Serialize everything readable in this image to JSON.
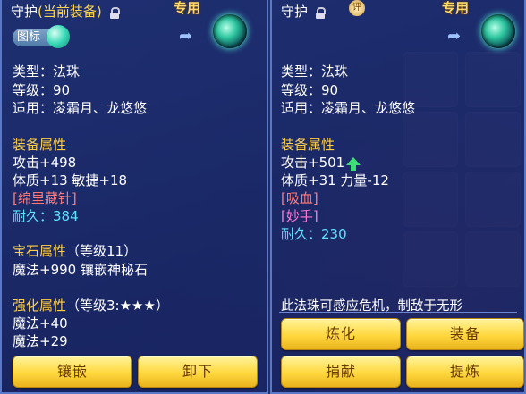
{
  "colors": {
    "gold": "#ffd04a",
    "red": "#ff7a7a",
    "pink": "#ff7ad7",
    "cyan": "#5fe3ff",
    "button": "#ffd83e"
  },
  "left": {
    "header_label": "守护",
    "header_current": "(当前装备)",
    "exclusive": "专用",
    "badge_label": "图标",
    "type": "类型：法珠",
    "level": "等级：90",
    "applies": "适用：凌霜月、龙悠悠",
    "equip_attr_title": "装备属性",
    "attack": "攻击+498",
    "stats": "体质+13 敏捷+18",
    "special": "[绵里藏针]",
    "durability": "耐久：384",
    "gem_title": "宝石属性",
    "gem_level": "（等级11）",
    "gem_value": "魔法+990 镶嵌神秘石",
    "enhance_title": "强化属性",
    "enhance_level": "（等级3:★★★）",
    "enhance_1": "魔法+40",
    "enhance_2": "魔法+29",
    "buttons": {
      "inlay": "镶嵌",
      "unequip": "卸下"
    }
  },
  "right": {
    "header_label": "守护",
    "seal_glyph": "评",
    "exclusive": "专用",
    "type": "类型：法珠",
    "level": "等级：90",
    "applies": "适用：凌霜月、龙悠悠",
    "equip_attr_title": "装备属性",
    "attack": "攻击+501",
    "stats": "体质+31 力量-12",
    "special_1": "[吸血]",
    "special_2": "[妙手]",
    "durability": "耐久：230",
    "description": "此法珠可感应危机，制敌于无形",
    "buttons": {
      "refine": "炼化",
      "equip": "装备",
      "donate": "捐献",
      "extract": "提炼"
    }
  }
}
